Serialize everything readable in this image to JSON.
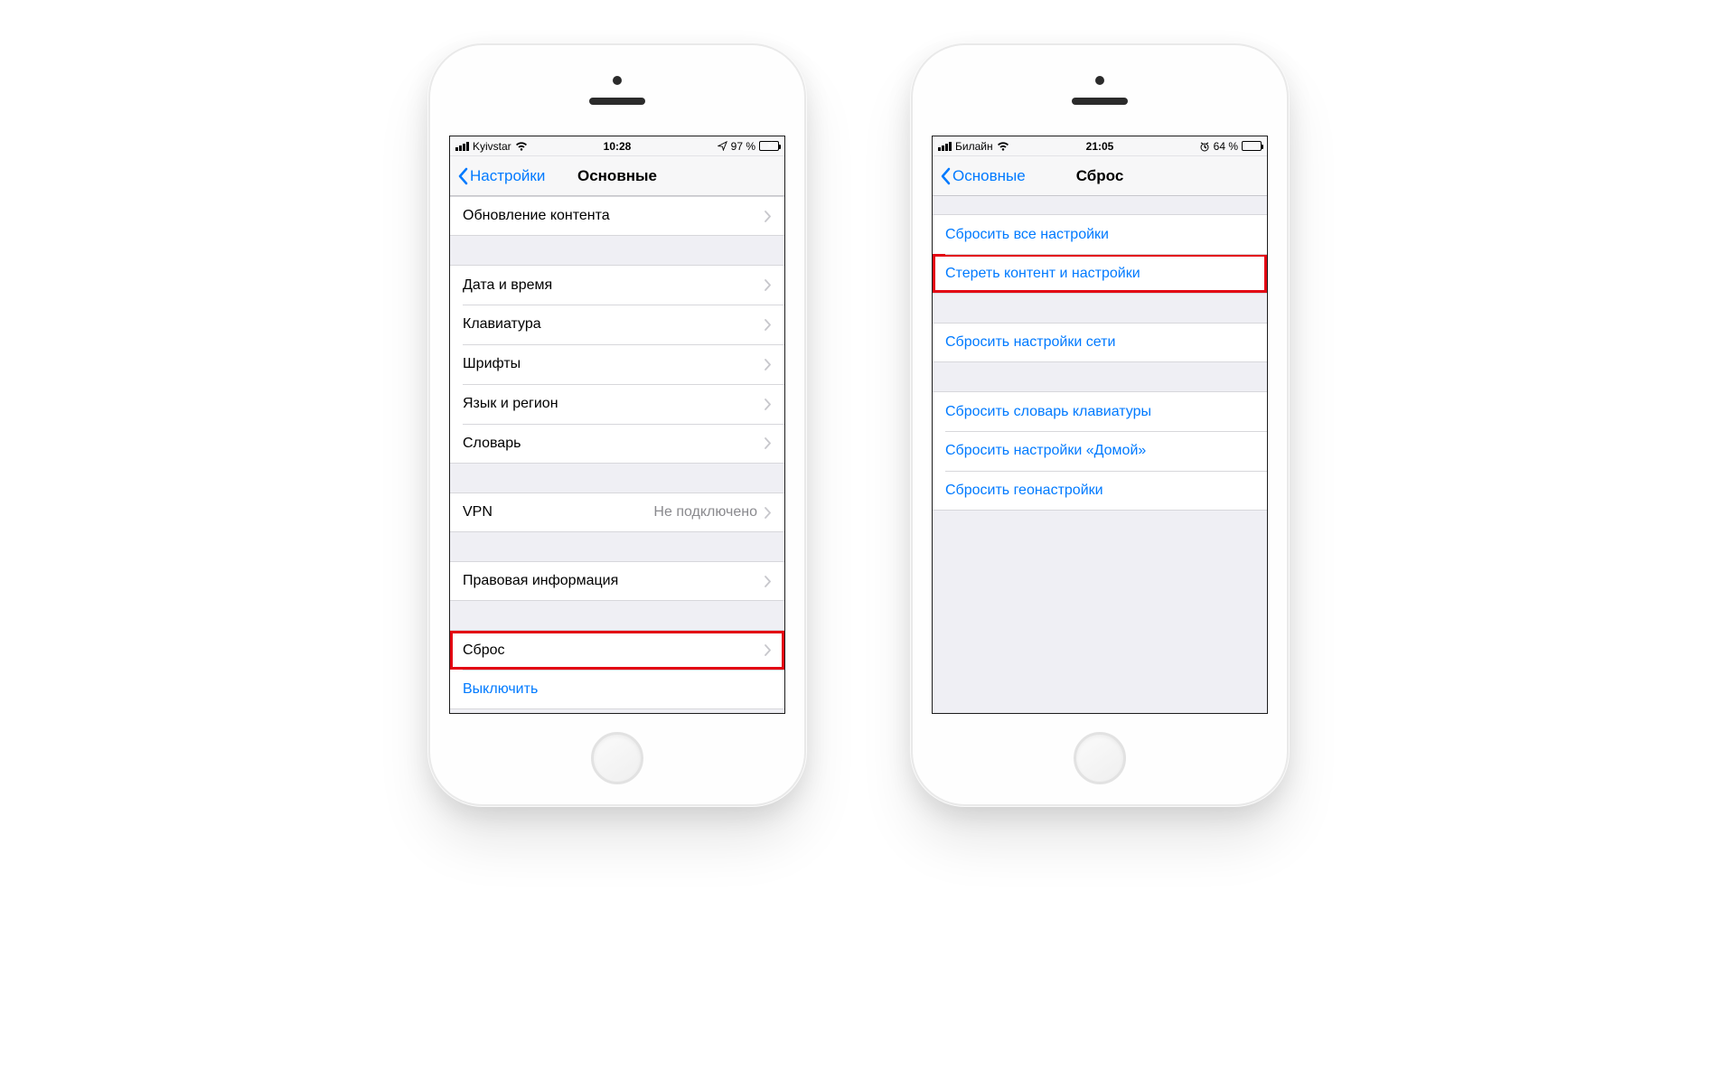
{
  "left": {
    "status": {
      "carrier": "Kyivstar",
      "time": "10:28",
      "battery_text": "97 %",
      "battery_pct": 97,
      "charging": true
    },
    "nav": {
      "back": "Настройки",
      "title": "Основные"
    },
    "groups": [
      {
        "items": [
          {
            "label": "Обновление контента"
          }
        ]
      },
      {
        "items": [
          {
            "label": "Дата и время"
          },
          {
            "label": "Клавиатура"
          },
          {
            "label": "Шрифты"
          },
          {
            "label": "Язык и регион"
          },
          {
            "label": "Словарь"
          }
        ]
      },
      {
        "items": [
          {
            "label": "VPN",
            "value": "Не подключено"
          }
        ]
      },
      {
        "items": [
          {
            "label": "Правовая информация"
          }
        ]
      },
      {
        "items": [
          {
            "label": "Сброс",
            "highlight": true
          },
          {
            "label": "Выключить",
            "blue": true,
            "no_chevron": true
          }
        ]
      }
    ]
  },
  "right": {
    "status": {
      "carrier": "Билайн",
      "time": "21:05",
      "battery_text": "64 %",
      "battery_pct": 64,
      "alarm": true
    },
    "nav": {
      "back": "Основные",
      "title": "Сброс"
    },
    "groups": [
      {
        "items": [
          {
            "label": "Сбросить все настройки",
            "blue": true
          },
          {
            "label": "Стереть контент и настройки",
            "blue": true,
            "highlight": true
          }
        ]
      },
      {
        "items": [
          {
            "label": "Сбросить настройки сети",
            "blue": true
          }
        ]
      },
      {
        "items": [
          {
            "label": "Сбросить словарь клавиатуры",
            "blue": true
          },
          {
            "label": "Сбросить настройки «Домой»",
            "blue": true
          },
          {
            "label": "Сбросить геонастройки",
            "blue": true
          }
        ]
      }
    ]
  }
}
